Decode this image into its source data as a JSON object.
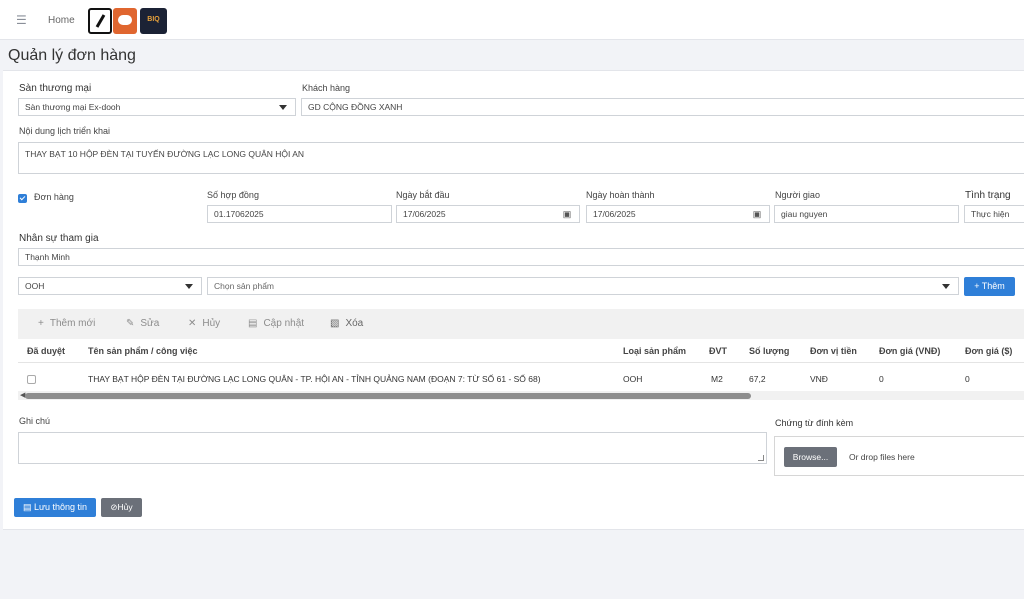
{
  "topbar": {
    "home": "Home",
    "logo3_line1": "BIQ",
    "logo3_line2": ""
  },
  "page": {
    "title": "Quản lý đơn hàng"
  },
  "form": {
    "marketplace_label": "Sàn thương mại",
    "marketplace_value": "Sàn thương mại Ex-dooh",
    "customer_label": "Khách hàng",
    "customer_value": "GD CỘNG ĐỒNG XANH",
    "content_label": "Nội dung lịch triển khai",
    "content_value": "THAY BẠT 10 HỘP ĐÈN TẠI TUYẾN ĐƯỜNG LẠC LONG QUÂN HỘI AN",
    "order_checkbox_label": "Đơn hàng",
    "contract_label": "Số hợp đồng",
    "contract_value": "01.17062025",
    "start_label": "Ngày bắt đầu",
    "start_value": "17/06/2025",
    "finish_label": "Ngày hoàn thành",
    "finish_value": "17/06/2025",
    "assigner_label": "Người giao",
    "assigner_value": "giau nguyen",
    "status_label": "Tình trạng",
    "status_value": "Thực hiện",
    "staff_label": "Nhân sự tham gia",
    "staff_value": "Thạnh Minh",
    "category_value": "OOH",
    "product_placeholder": "Chọn sản phẩm",
    "add_button": "Thêm"
  },
  "toolbar": {
    "add_new": "Thêm mới",
    "edit": "Sửa",
    "cancel": "Hủy",
    "update": "Cập nhật",
    "delete": "Xóa"
  },
  "table": {
    "headers": [
      "Đã duyệt",
      "Tên sản phẩm / công việc",
      "Loại sản phẩm",
      "ĐVT",
      "Số lượng",
      "Đơn vị tiền",
      "Đơn giá (VNĐ)",
      "Đơn giá ($)"
    ],
    "rows": [
      {
        "approved": false,
        "name": "THAY BẠT HỘP ĐÈN TẠI ĐƯỜNG LẠC LONG QUÂN - TP. HỘI AN - TỈNH QUẢNG NAM (ĐOẠN 7: TỪ SỐ 61 - SỐ 68)",
        "type": "OOH",
        "unit": "M2",
        "qty": "67,2",
        "currency": "VNĐ",
        "price_vnd": "0",
        "price_usd": "0"
      }
    ]
  },
  "notes": {
    "label": "Ghi chú",
    "value": ""
  },
  "attachments": {
    "label": "Chứng từ đính kèm",
    "browse": "Browse...",
    "drop": "Or drop files here"
  },
  "footer": {
    "save": "Lưu thông tin",
    "cancel": "Hủy"
  },
  "colors": {
    "primary": "#2f7fd8",
    "secondary": "#6b7079"
  }
}
